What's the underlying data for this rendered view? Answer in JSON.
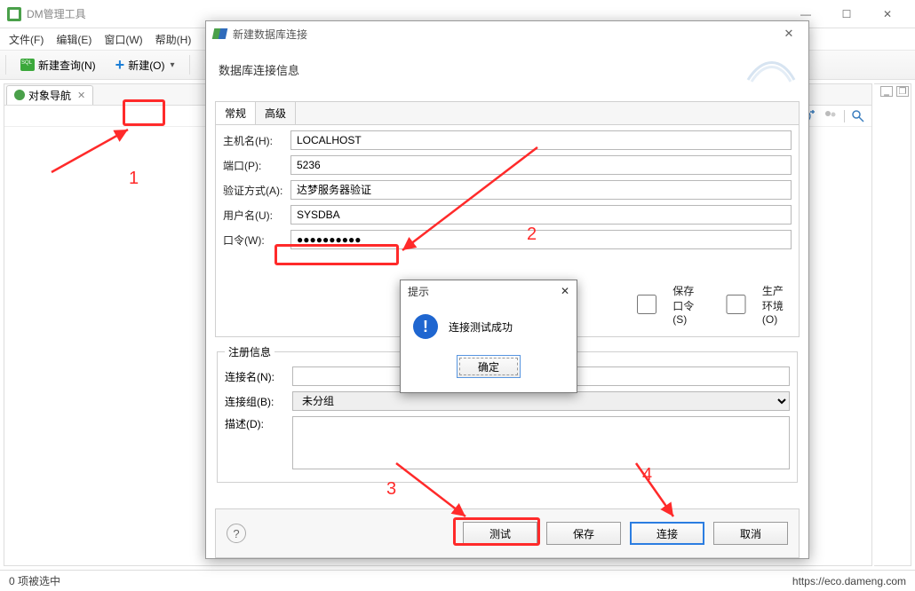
{
  "main": {
    "title": "DM管理工具",
    "menus": [
      "文件(F)",
      "编辑(E)",
      "窗口(W)",
      "帮助(H)"
    ],
    "toolbar": {
      "newQuery": "新建查询(N)",
      "newItem": "新建(O)"
    },
    "navTab": "对象导航",
    "status": "0 项被选中",
    "statusLink": "https://eco.dameng.com"
  },
  "dialog": {
    "title": "新建数据库连接",
    "header": "数据库连接信息",
    "tabs": {
      "general": "常规",
      "advanced": "高级"
    },
    "fields": {
      "hostLabel": "主机名(H):",
      "hostValue": "LOCALHOST",
      "portLabel": "端口(P):",
      "portValue": "5236",
      "authLabel": "验证方式(A):",
      "authValue": "达梦服务器验证",
      "userLabel": "用户名(U):",
      "userValue": "SYSDBA",
      "pwdLabel": "口令(W):",
      "pwdValue": "●●●●●●●●●●"
    },
    "checks": {
      "savePwd": "保存口令(S)",
      "prodEnv": "生产环境(O)"
    },
    "reg": {
      "legend": "注册信息",
      "nameLabel": "连接名(N):",
      "nameValue": "",
      "groupLabel": "连接组(B):",
      "groupValue": "未分组",
      "descLabel": "描述(D):",
      "descValue": ""
    },
    "buttons": {
      "test": "测试",
      "save": "保存",
      "connect": "连接",
      "cancel": "取消"
    }
  },
  "msg": {
    "title": "提示",
    "text": "连接测试成功",
    "ok": "确定"
  },
  "ann": {
    "n1": "1",
    "n2": "2",
    "n3": "3",
    "n4": "4"
  }
}
